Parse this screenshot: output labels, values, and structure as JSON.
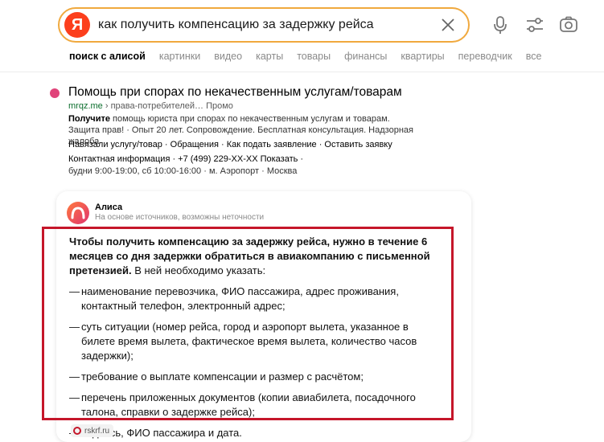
{
  "search": {
    "logo_letter": "Я",
    "query": "как получить компенсацию за задержку рейса"
  },
  "icons": {
    "clear": "close-icon",
    "voice": "microphone-icon",
    "filters": "filter-icon",
    "camera": "camera-search-icon"
  },
  "tabs": [
    "поиск с алисой",
    "картинки",
    "видео",
    "карты",
    "товары",
    "финансы",
    "квартиры",
    "переводчик",
    "все"
  ],
  "ad": {
    "title": "Помощь при спорах по некачественным услугам/товарам",
    "domain": "mrqz.me",
    "path": "› права-потребителей…",
    "label": "Промо",
    "desc_bold": "Получите",
    "desc_text": " помощь юриста при спорах по некачественным услугам и товарам. Защита прав! · Опыт 20 лет. Сопровождение. Бесплатная консультация. Надзорная жалоба",
    "links": "Навязали услугу/товар  ·  Обращения  ·  Как подать заявление  ·  Оставить заявку",
    "contact": "Контактная информация  ·  +7 (499) 229-XX-XX Показать  ·",
    "hours": "будни 9:00-19:00, сб 10:00-16:00  ·  м. Аэропорт  ·  Москва"
  },
  "alice": {
    "name": "Алиса",
    "subtitle": "На основе источников, возможны неточности",
    "lead_bold": "Чтобы получить компенсацию за задержку рейса, нужно в течение 6 месяцев со дня задержки обратиться в авиакомпанию с письменной претензией.",
    "lead_text": " В ней необходимо указать:",
    "dash": "—",
    "items": [
      "наименование перевозчика, ФИО пассажира, адрес проживания, контактный телефон, электронный адрес;",
      "суть ситуации (номер рейса, город и аэропорт вылета, указанное в билете время вылета, фактическое время вылета, количество часов задержки);",
      "требование о выплате компенсации и размер с расчётом;",
      "перечень приложенных документов (копии авиабилета, посадочного талона, справки о задержке рейса);",
      "подпись, ФИО пассажира и дата."
    ],
    "source": "rskrf.ru"
  },
  "colors": {
    "highlight_border": "#c5162a",
    "search_border": "#f0a93e",
    "yandex_red": "#fc3f1d",
    "ad_dot": "#e0447a"
  }
}
